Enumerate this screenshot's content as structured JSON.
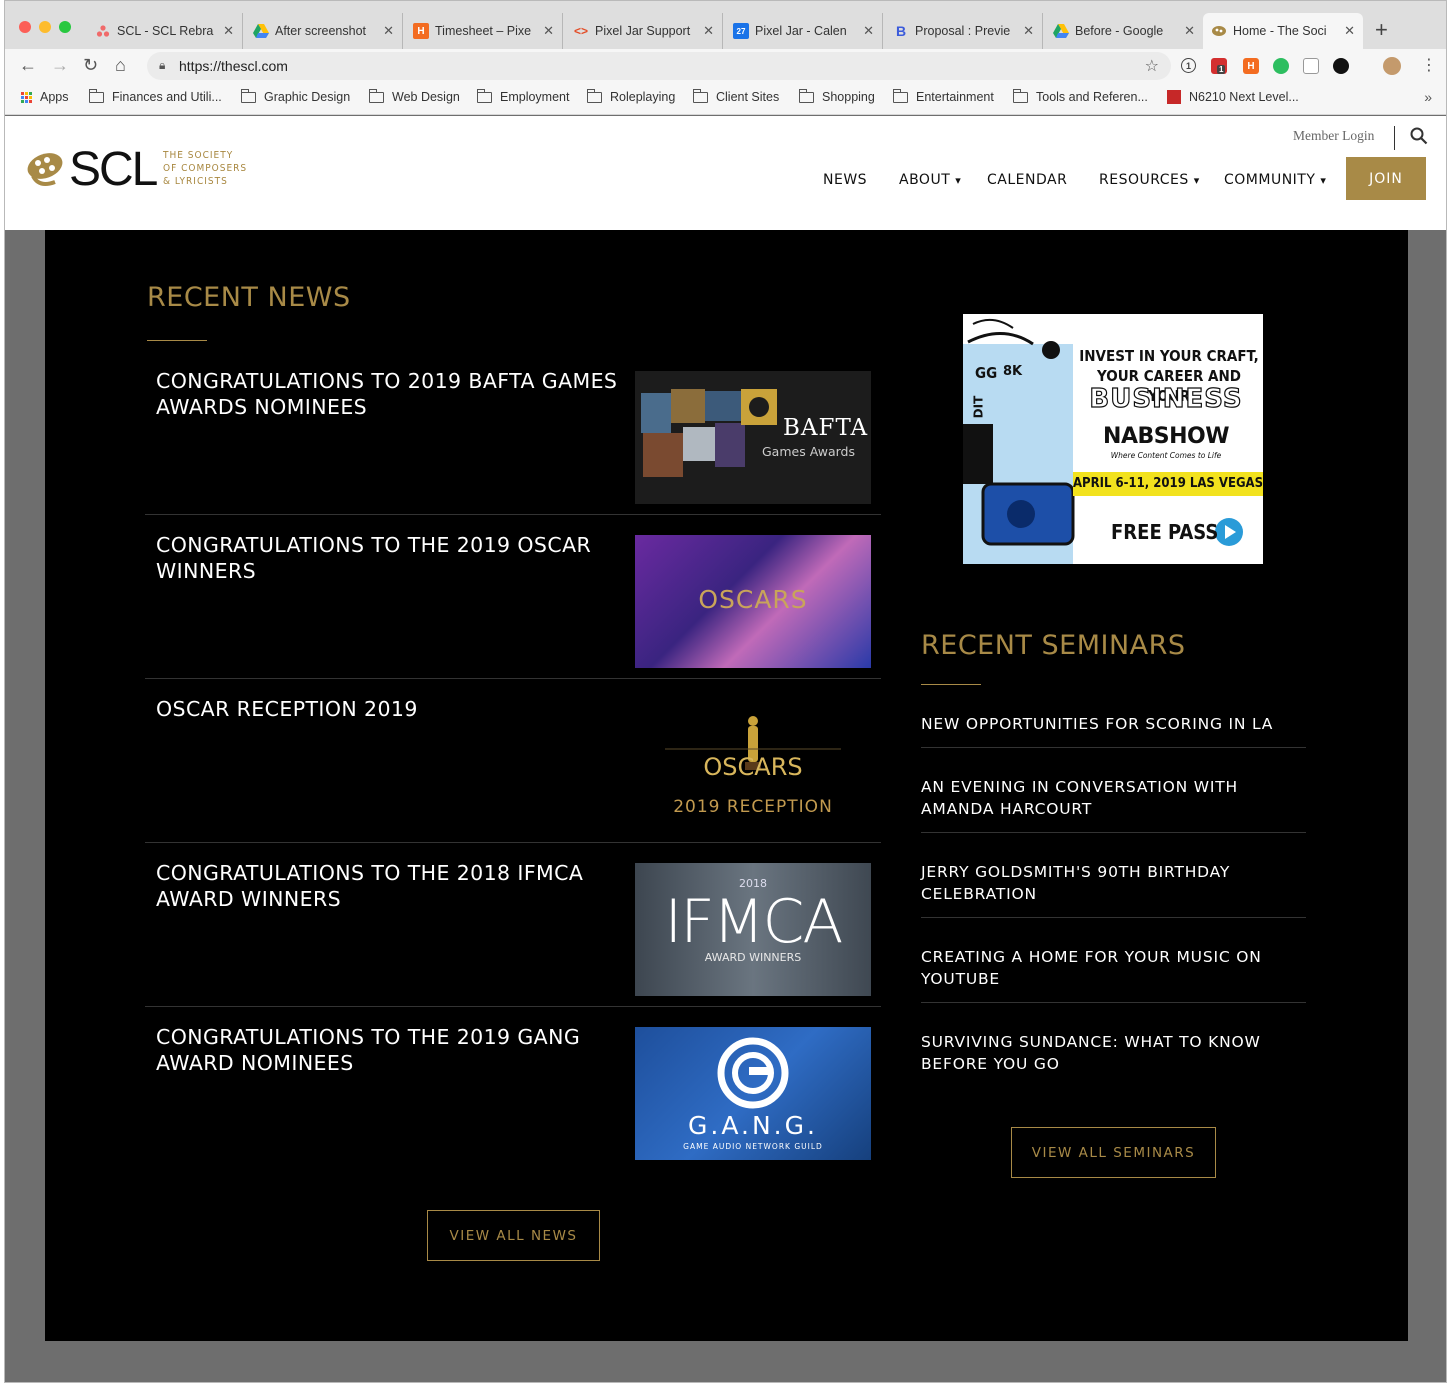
{
  "browser": {
    "tabs": [
      {
        "title": "SCL - SCL Rebra",
        "icon": "asana-icon",
        "color": "#f06a6a"
      },
      {
        "title": "After screenshot",
        "icon": "google-drive-icon",
        "color": "#1fa463"
      },
      {
        "title": "Timesheet – Pixe",
        "icon": "harvest-icon",
        "color": "#f36c21"
      },
      {
        "title": "Pixel Jar Support",
        "icon": "code-icon",
        "color": "#e34c26"
      },
      {
        "title": "Pixel Jar - Calen",
        "icon": "calendar-icon",
        "color": "#1a73e8"
      },
      {
        "title": "Proposal : Previe",
        "icon": "bidsketch-icon",
        "color": "#3b5bdb"
      },
      {
        "title": "Before - Google",
        "icon": "google-drive-icon",
        "color": "#1fa463"
      },
      {
        "title": "Home - The Soci",
        "icon": "scl-reel-icon",
        "color": "#a88a47"
      }
    ],
    "url": "https://thescl.com",
    "bookmarks": [
      "Apps",
      "Finances and Utili...",
      "Graphic Design",
      "Web Design",
      "Employment",
      "Roleplaying",
      "Client Sites",
      "Shopping",
      "Entertainment",
      "Tools and Referen...",
      "N6210 Next Level..."
    ],
    "ext_badge": "1",
    "more": "»"
  },
  "site": {
    "logo": {
      "wordmark": "SCL",
      "line1": "THE SOCIETY",
      "line2": "OF COMPOSERS",
      "line3": "& LYRICISTS"
    },
    "member_login": "Member Login",
    "nav": [
      {
        "label": "NEWS",
        "caret": ""
      },
      {
        "label": "ABOUT",
        "caret": "⌄"
      },
      {
        "label": "CALENDAR",
        "caret": ""
      },
      {
        "label": "RESOURCES",
        "caret": "⌄"
      },
      {
        "label": "COMMUNITY",
        "caret": "⌄"
      }
    ],
    "join": "JOIN",
    "colors": {
      "gold": "#a88a47",
      "black": "#000000"
    }
  },
  "news": {
    "heading": "RECENT NEWS",
    "items": [
      {
        "title": "CONGRATULATIONS TO 2019 BAFTA GAMES AWARDS NOMINEES",
        "thumb_text": "BAFTA",
        "thumb_sub": "Games Awards"
      },
      {
        "title": "CONGRATULATIONS TO THE 2019 OSCAR WINNERS",
        "thumb_text": "OSCARS"
      },
      {
        "title": "OSCAR RECEPTION 2019",
        "thumb_text": "OSCARS",
        "thumb_sub": "2019 RECEPTION"
      },
      {
        "title": "CONGRATULATIONS TO THE 2018 IFMCA AWARD WINNERS",
        "thumb_text": "IFMCA",
        "thumb_top": "2018",
        "thumb_sub": "AWARD WINNERS"
      },
      {
        "title": "CONGRATULATIONS TO THE 2019 GANG AWARD NOMINEES",
        "thumb_text": "G.A.N.G.",
        "thumb_sub": "GAME AUDIO NETWORK GUILD"
      }
    ],
    "view_all": "VIEW ALL NEWS"
  },
  "ad": {
    "headline1": "INVEST IN YOUR CRAFT,",
    "headline2": "YOUR CAREER AND YOUR",
    "headline3": "BUSINESS",
    "brand": "NABSHOW",
    "tagline": "Where Content Comes to Life",
    "dates": "APRIL 6-11, 2019  LAS VEGAS",
    "cta": "FREE PASS",
    "doodle1": "GG",
    "doodle2": "8K",
    "doodle3": "DIT"
  },
  "seminars": {
    "heading": "RECENT SEMINARS",
    "items": [
      {
        "title": "NEW OPPORTUNITIES FOR SCORING IN LA"
      },
      {
        "title": "AN EVENING IN CONVERSATION WITH AMANDA HARCOURT"
      },
      {
        "title": "JERRY GOLDSMITH'S 90TH BIRTHDAY CELEBRATION"
      },
      {
        "title": "CREATING A HOME FOR YOUR MUSIC ON YOUTUBE"
      },
      {
        "title": "SURVIVING SUNDANCE: WHAT TO KNOW BEFORE YOU GO"
      }
    ],
    "view_all": "VIEW ALL SEMINARS"
  }
}
